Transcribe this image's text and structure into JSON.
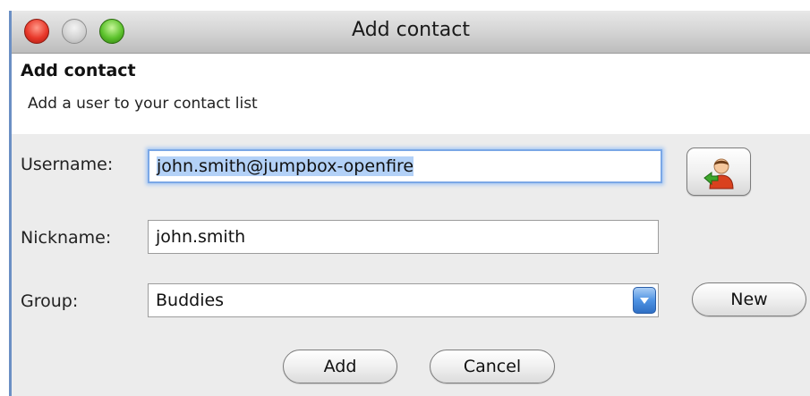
{
  "window": {
    "title": "Add contact"
  },
  "header": {
    "title": "Add contact",
    "subtitle": "Add a user to your contact list"
  },
  "form": {
    "username": {
      "label": "Username:",
      "value": "john.smith@jumpbox-openfire"
    },
    "nickname": {
      "label": "Nickname:",
      "value": "john.smith"
    },
    "group": {
      "label": "Group:",
      "selected": "Buddies"
    }
  },
  "buttons": {
    "new_label": "New",
    "add_label": "Add",
    "cancel_label": "Cancel"
  },
  "icons": {
    "user_search": "user-search-icon",
    "dropdown": "chevron-down-icon"
  },
  "colors": {
    "focus_ring": "#7aa7e6",
    "selection": "#b3d1f7",
    "combo_arrow": "#4f93e3"
  }
}
